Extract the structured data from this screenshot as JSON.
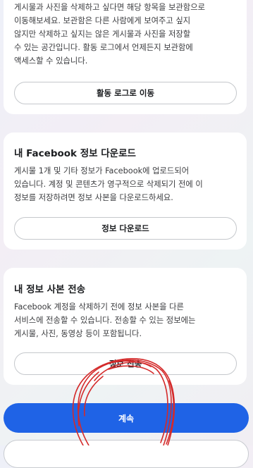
{
  "card_archive": {
    "description_lines": [
      "게시물과 사진을 삭제하고 싶다면 해당 항목을 보관함으로",
      "이동해보세요. 보관함은 다른 사람에게 보여주고 싶지",
      "않지만 삭제하고 싶지는 않은 게시물과 사진을 저장할",
      "수 있는 공간입니다. 활동 로그에서 언제든지 보관함에",
      "액세스할 수 있습니다."
    ],
    "button_label": "활동 로그로 이동"
  },
  "card_download": {
    "title": "내 Facebook 정보 다운로드",
    "description_lines": [
      "게시물 1개 및 기타 정보가 Facebook에 업로드되어",
      "있습니다. 계정 및 콘텐츠가 영구적으로 삭제되기 전에 이",
      "정보를 저장하려면 정보 사본을 다운로드하세요."
    ],
    "button_label": "정보 다운로드"
  },
  "card_transfer": {
    "title": "내 정보 사본 전송",
    "description_lines": [
      "Facebook 계정을 삭제하기 전에 정보 사본을 다른",
      "서비스에 전송할 수 있습니다. 전송할 수 있는 정보에는",
      "게시물, 사진, 동영상 등이 포함됩니다."
    ],
    "button_label": "정보 전송"
  },
  "footer": {
    "continue_label": "계속"
  },
  "colors": {
    "primary_button": "#1f63e6",
    "scribble": "#d42a2a"
  }
}
